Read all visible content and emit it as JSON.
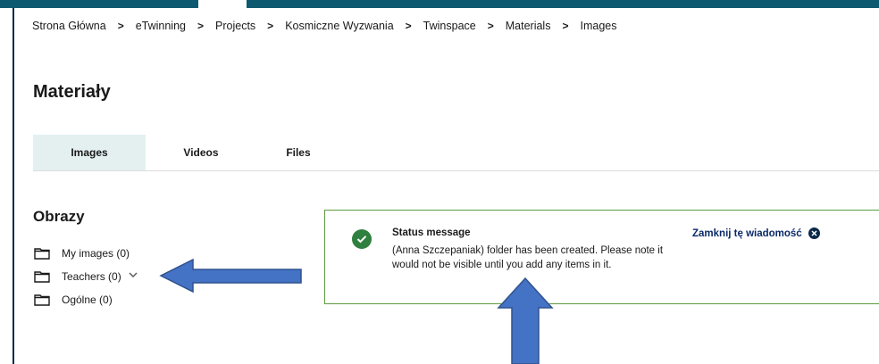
{
  "breadcrumb": {
    "items": [
      "Strona Główna",
      "eTwinning",
      "Projects",
      "Kosmiczne Wyzwania",
      "Twinspace",
      "Materials",
      "Images"
    ],
    "separator": ">"
  },
  "page": {
    "title": "Materiały"
  },
  "tabs": [
    {
      "label": "Images",
      "active": true
    },
    {
      "label": "Videos",
      "active": false
    },
    {
      "label": "Files",
      "active": false
    }
  ],
  "sidebar": {
    "title": "Obrazy",
    "folders": [
      {
        "label": "My images (0)",
        "icon": "folder-icon"
      },
      {
        "label": "Teachers (0)",
        "icon": "folder-icon"
      },
      {
        "label": "Ogólne (0)",
        "icon": "folder-icon"
      }
    ]
  },
  "status": {
    "heading": "Status message",
    "text": "(Anna Szczepaniak) folder has been created. Please note it would not be visible until you add any items in it.",
    "close_label": "Zamknij tę wiadomość",
    "icon": "check-circle-icon"
  },
  "colors": {
    "topbar": "#0d5a70",
    "active_tab": "#e4f0f0",
    "success": "#2f7f3f",
    "status_border": "#5e9a3e",
    "arrow_fill": "#4472c4",
    "arrow_stroke": "#2f528f",
    "link": "#0b2a6a"
  }
}
